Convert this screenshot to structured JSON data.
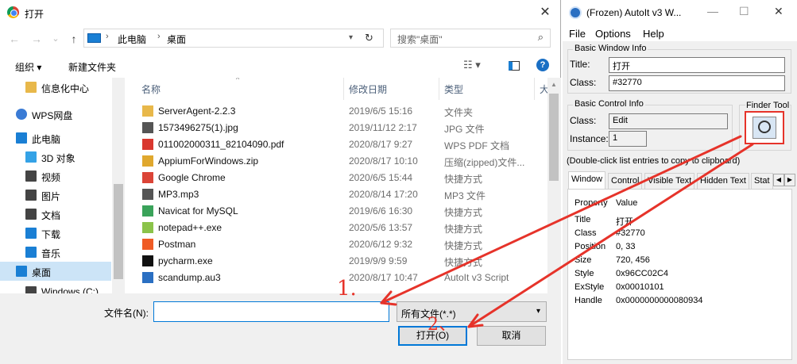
{
  "dialog": {
    "title": "打开",
    "close": "✕",
    "nav": {
      "back": "←",
      "forward": "→",
      "down": "⌄",
      "up": "↑",
      "refresh": "↻"
    },
    "address": [
      "此电脑",
      "桌面"
    ],
    "search_placeholder": "搜索\"桌面\"",
    "toolbar": {
      "organize": "组织 ▾",
      "new_folder": "新建文件夹"
    },
    "sidebar": [
      {
        "label": "信息化中心",
        "icon": "folder-icon",
        "color": "#e8b84a"
      },
      {
        "label": "WPS网盘",
        "icon": "cloud-icon",
        "color": "#3a7bd5"
      },
      {
        "label": "此电脑",
        "icon": "computer-icon",
        "color": "#1a7fd4"
      },
      {
        "label": "3D 对象",
        "icon": "cube-icon",
        "color": "#34a2e6"
      },
      {
        "label": "视频",
        "icon": "film-icon",
        "color": "#444"
      },
      {
        "label": "图片",
        "icon": "picture-icon",
        "color": "#444"
      },
      {
        "label": "文档",
        "icon": "document-icon",
        "color": "#444"
      },
      {
        "label": "下载",
        "icon": "download-icon",
        "color": "#1a7fd4"
      },
      {
        "label": "音乐",
        "icon": "music-icon",
        "color": "#1a7fd4"
      },
      {
        "label": "桌面",
        "icon": "desktop-icon",
        "color": "#1a7fd4"
      },
      {
        "label": "Windows (C:)",
        "icon": "drive-icon",
        "color": "#444"
      }
    ],
    "columns": {
      "name": "名称",
      "date": "修改日期",
      "type": "类型",
      "size": "大"
    },
    "files": [
      {
        "name": "ServerAgent-2.2.3",
        "date": "2019/6/5 15:16",
        "type": "文件夹",
        "icon": "folder-icon",
        "color": "#e8b84a"
      },
      {
        "name": "1573496275(1).jpg",
        "date": "2019/11/12 2:17",
        "type": "JPG 文件",
        "icon": "image-file-icon",
        "color": "#555"
      },
      {
        "name": "011002000311_82104090.pdf",
        "date": "2020/8/17 9:27",
        "type": "WPS PDF 文档",
        "icon": "pdf-icon",
        "color": "#d9382f"
      },
      {
        "name": "AppiumForWindows.zip",
        "date": "2020/8/17 10:10",
        "type": "压缩(zipped)文件...",
        "icon": "zip-icon",
        "color": "#e0a82e"
      },
      {
        "name": "Google Chrome",
        "date": "2020/6/5 15:44",
        "type": "快捷方式",
        "icon": "chrome-icon",
        "color": "#db4437"
      },
      {
        "name": "MP3.mp3",
        "date": "2020/8/14 17:20",
        "type": "MP3 文件",
        "icon": "audio-file-icon",
        "color": "#555"
      },
      {
        "name": "Navicat for MySQL",
        "date": "2019/6/6 16:30",
        "type": "快捷方式",
        "icon": "navicat-icon",
        "color": "#3aa35a"
      },
      {
        "name": "notepad++.exe",
        "date": "2020/5/6 13:57",
        "type": "快捷方式",
        "icon": "notepad-icon",
        "color": "#8bc34a"
      },
      {
        "name": "Postman",
        "date": "2020/6/12 9:32",
        "type": "快捷方式",
        "icon": "postman-icon",
        "color": "#ef5b25"
      },
      {
        "name": "pycharm.exe",
        "date": "2019/9/9 9:59",
        "type": "快捷方式",
        "icon": "pycharm-icon",
        "color": "#111"
      },
      {
        "name": "scandump.au3",
        "date": "2020/8/17 10:47",
        "type": "AutoIt v3 Script",
        "icon": "autoit-script-icon",
        "color": "#2a6fc2"
      }
    ],
    "filename_label": "文件名(N):",
    "filename_value": "",
    "filetype": "所有文件(*.*)",
    "open_label": "打开(O)",
    "cancel_label": "取消"
  },
  "autoit": {
    "title": "(Frozen) AutoIt v3 W...",
    "menu": [
      "File",
      "Options",
      "Help"
    ],
    "basic_window_info": "Basic Window Info",
    "title_label": "Title:",
    "title_value": "打开",
    "class_label": "Class:",
    "class_value": "#32770",
    "basic_control_info": "Basic Control Info",
    "ctrl_class_label": "Class:",
    "ctrl_class_value": "Edit",
    "instance_label": "Instance:",
    "instance_value": "1",
    "finder_tool": "Finder Tool",
    "hint": "(Double-click list entries to copy to clipboard)",
    "tabs": [
      "Window",
      "Control",
      "Visible Text",
      "Hidden Text",
      "Stat"
    ],
    "prop_header": "Property",
    "value_header": "Value",
    "properties": [
      {
        "k": "Title",
        "v": "打开"
      },
      {
        "k": "Class",
        "v": "#32770"
      },
      {
        "k": "Position",
        "v": "0, 33"
      },
      {
        "k": "Size",
        "v": "720, 456"
      },
      {
        "k": "Style",
        "v": "0x96CC02C4"
      },
      {
        "k": "ExStyle",
        "v": "0x00010101"
      },
      {
        "k": "Handle",
        "v": "0x0000000000080934"
      }
    ]
  },
  "annotations": {
    "step1": "1.",
    "step2": "2、",
    "color": "#e6332a"
  }
}
